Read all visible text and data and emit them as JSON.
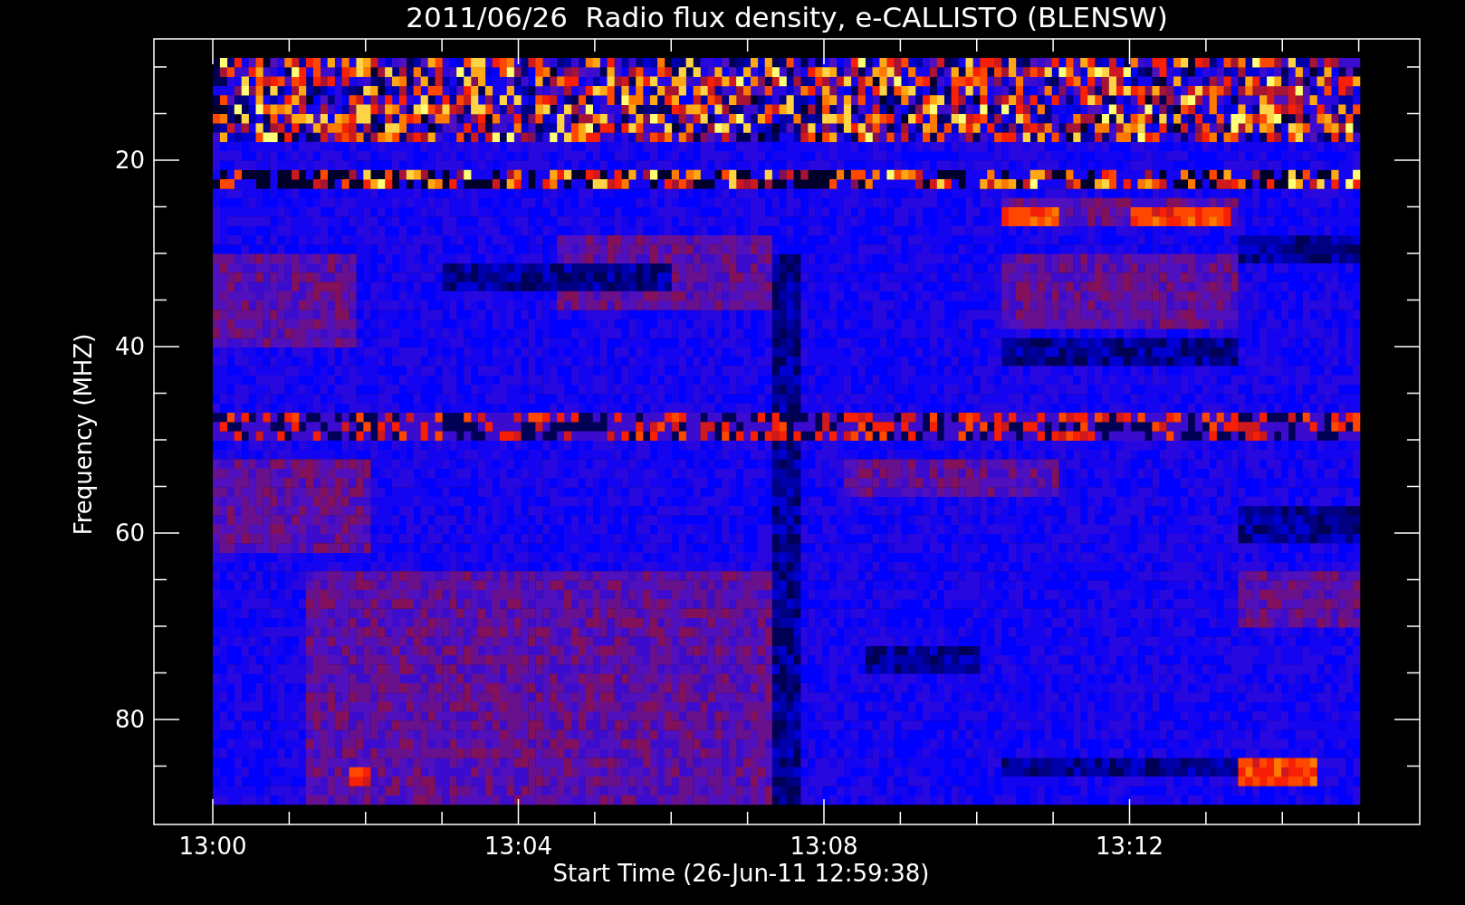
{
  "title": "2011/06/26  Radio flux density, e-CALLISTO (BLENSW)",
  "y_axis": {
    "label": "Frequency (MHZ)",
    "ticks": [
      "20",
      "40",
      "60",
      "80"
    ]
  },
  "x_axis": {
    "label": "Start Time (26-Jun-11 12:59:38)",
    "ticks": [
      "13:00",
      "13:04",
      "13:08",
      "13:12"
    ]
  }
}
